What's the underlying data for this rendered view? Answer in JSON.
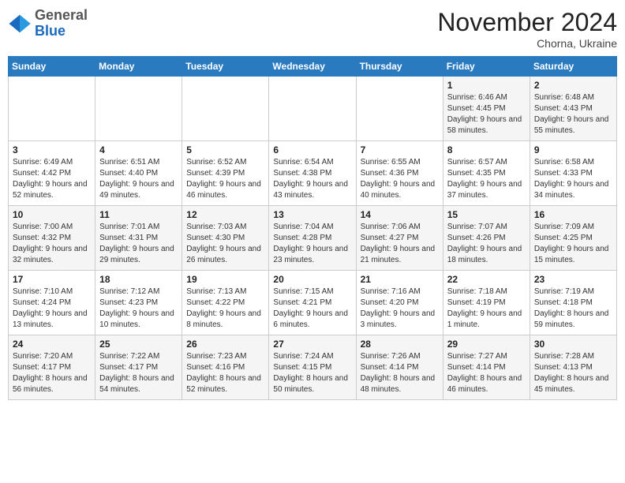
{
  "logo": {
    "general": "General",
    "blue": "Blue"
  },
  "title": "November 2024",
  "location": "Chorna, Ukraine",
  "days_of_week": [
    "Sunday",
    "Monday",
    "Tuesday",
    "Wednesday",
    "Thursday",
    "Friday",
    "Saturday"
  ],
  "weeks": [
    [
      {
        "day": "",
        "info": ""
      },
      {
        "day": "",
        "info": ""
      },
      {
        "day": "",
        "info": ""
      },
      {
        "day": "",
        "info": ""
      },
      {
        "day": "",
        "info": ""
      },
      {
        "day": "1",
        "info": "Sunrise: 6:46 AM\nSunset: 4:45 PM\nDaylight: 9 hours and 58 minutes."
      },
      {
        "day": "2",
        "info": "Sunrise: 6:48 AM\nSunset: 4:43 PM\nDaylight: 9 hours and 55 minutes."
      }
    ],
    [
      {
        "day": "3",
        "info": "Sunrise: 6:49 AM\nSunset: 4:42 PM\nDaylight: 9 hours and 52 minutes."
      },
      {
        "day": "4",
        "info": "Sunrise: 6:51 AM\nSunset: 4:40 PM\nDaylight: 9 hours and 49 minutes."
      },
      {
        "day": "5",
        "info": "Sunrise: 6:52 AM\nSunset: 4:39 PM\nDaylight: 9 hours and 46 minutes."
      },
      {
        "day": "6",
        "info": "Sunrise: 6:54 AM\nSunset: 4:38 PM\nDaylight: 9 hours and 43 minutes."
      },
      {
        "day": "7",
        "info": "Sunrise: 6:55 AM\nSunset: 4:36 PM\nDaylight: 9 hours and 40 minutes."
      },
      {
        "day": "8",
        "info": "Sunrise: 6:57 AM\nSunset: 4:35 PM\nDaylight: 9 hours and 37 minutes."
      },
      {
        "day": "9",
        "info": "Sunrise: 6:58 AM\nSunset: 4:33 PM\nDaylight: 9 hours and 34 minutes."
      }
    ],
    [
      {
        "day": "10",
        "info": "Sunrise: 7:00 AM\nSunset: 4:32 PM\nDaylight: 9 hours and 32 minutes."
      },
      {
        "day": "11",
        "info": "Sunrise: 7:01 AM\nSunset: 4:31 PM\nDaylight: 9 hours and 29 minutes."
      },
      {
        "day": "12",
        "info": "Sunrise: 7:03 AM\nSunset: 4:30 PM\nDaylight: 9 hours and 26 minutes."
      },
      {
        "day": "13",
        "info": "Sunrise: 7:04 AM\nSunset: 4:28 PM\nDaylight: 9 hours and 23 minutes."
      },
      {
        "day": "14",
        "info": "Sunrise: 7:06 AM\nSunset: 4:27 PM\nDaylight: 9 hours and 21 minutes."
      },
      {
        "day": "15",
        "info": "Sunrise: 7:07 AM\nSunset: 4:26 PM\nDaylight: 9 hours and 18 minutes."
      },
      {
        "day": "16",
        "info": "Sunrise: 7:09 AM\nSunset: 4:25 PM\nDaylight: 9 hours and 15 minutes."
      }
    ],
    [
      {
        "day": "17",
        "info": "Sunrise: 7:10 AM\nSunset: 4:24 PM\nDaylight: 9 hours and 13 minutes."
      },
      {
        "day": "18",
        "info": "Sunrise: 7:12 AM\nSunset: 4:23 PM\nDaylight: 9 hours and 10 minutes."
      },
      {
        "day": "19",
        "info": "Sunrise: 7:13 AM\nSunset: 4:22 PM\nDaylight: 9 hours and 8 minutes."
      },
      {
        "day": "20",
        "info": "Sunrise: 7:15 AM\nSunset: 4:21 PM\nDaylight: 9 hours and 6 minutes."
      },
      {
        "day": "21",
        "info": "Sunrise: 7:16 AM\nSunset: 4:20 PM\nDaylight: 9 hours and 3 minutes."
      },
      {
        "day": "22",
        "info": "Sunrise: 7:18 AM\nSunset: 4:19 PM\nDaylight: 9 hours and 1 minute."
      },
      {
        "day": "23",
        "info": "Sunrise: 7:19 AM\nSunset: 4:18 PM\nDaylight: 8 hours and 59 minutes."
      }
    ],
    [
      {
        "day": "24",
        "info": "Sunrise: 7:20 AM\nSunset: 4:17 PM\nDaylight: 8 hours and 56 minutes."
      },
      {
        "day": "25",
        "info": "Sunrise: 7:22 AM\nSunset: 4:17 PM\nDaylight: 8 hours and 54 minutes."
      },
      {
        "day": "26",
        "info": "Sunrise: 7:23 AM\nSunset: 4:16 PM\nDaylight: 8 hours and 52 minutes."
      },
      {
        "day": "27",
        "info": "Sunrise: 7:24 AM\nSunset: 4:15 PM\nDaylight: 8 hours and 50 minutes."
      },
      {
        "day": "28",
        "info": "Sunrise: 7:26 AM\nSunset: 4:14 PM\nDaylight: 8 hours and 48 minutes."
      },
      {
        "day": "29",
        "info": "Sunrise: 7:27 AM\nSunset: 4:14 PM\nDaylight: 8 hours and 46 minutes."
      },
      {
        "day": "30",
        "info": "Sunrise: 7:28 AM\nSunset: 4:13 PM\nDaylight: 8 hours and 45 minutes."
      }
    ]
  ]
}
